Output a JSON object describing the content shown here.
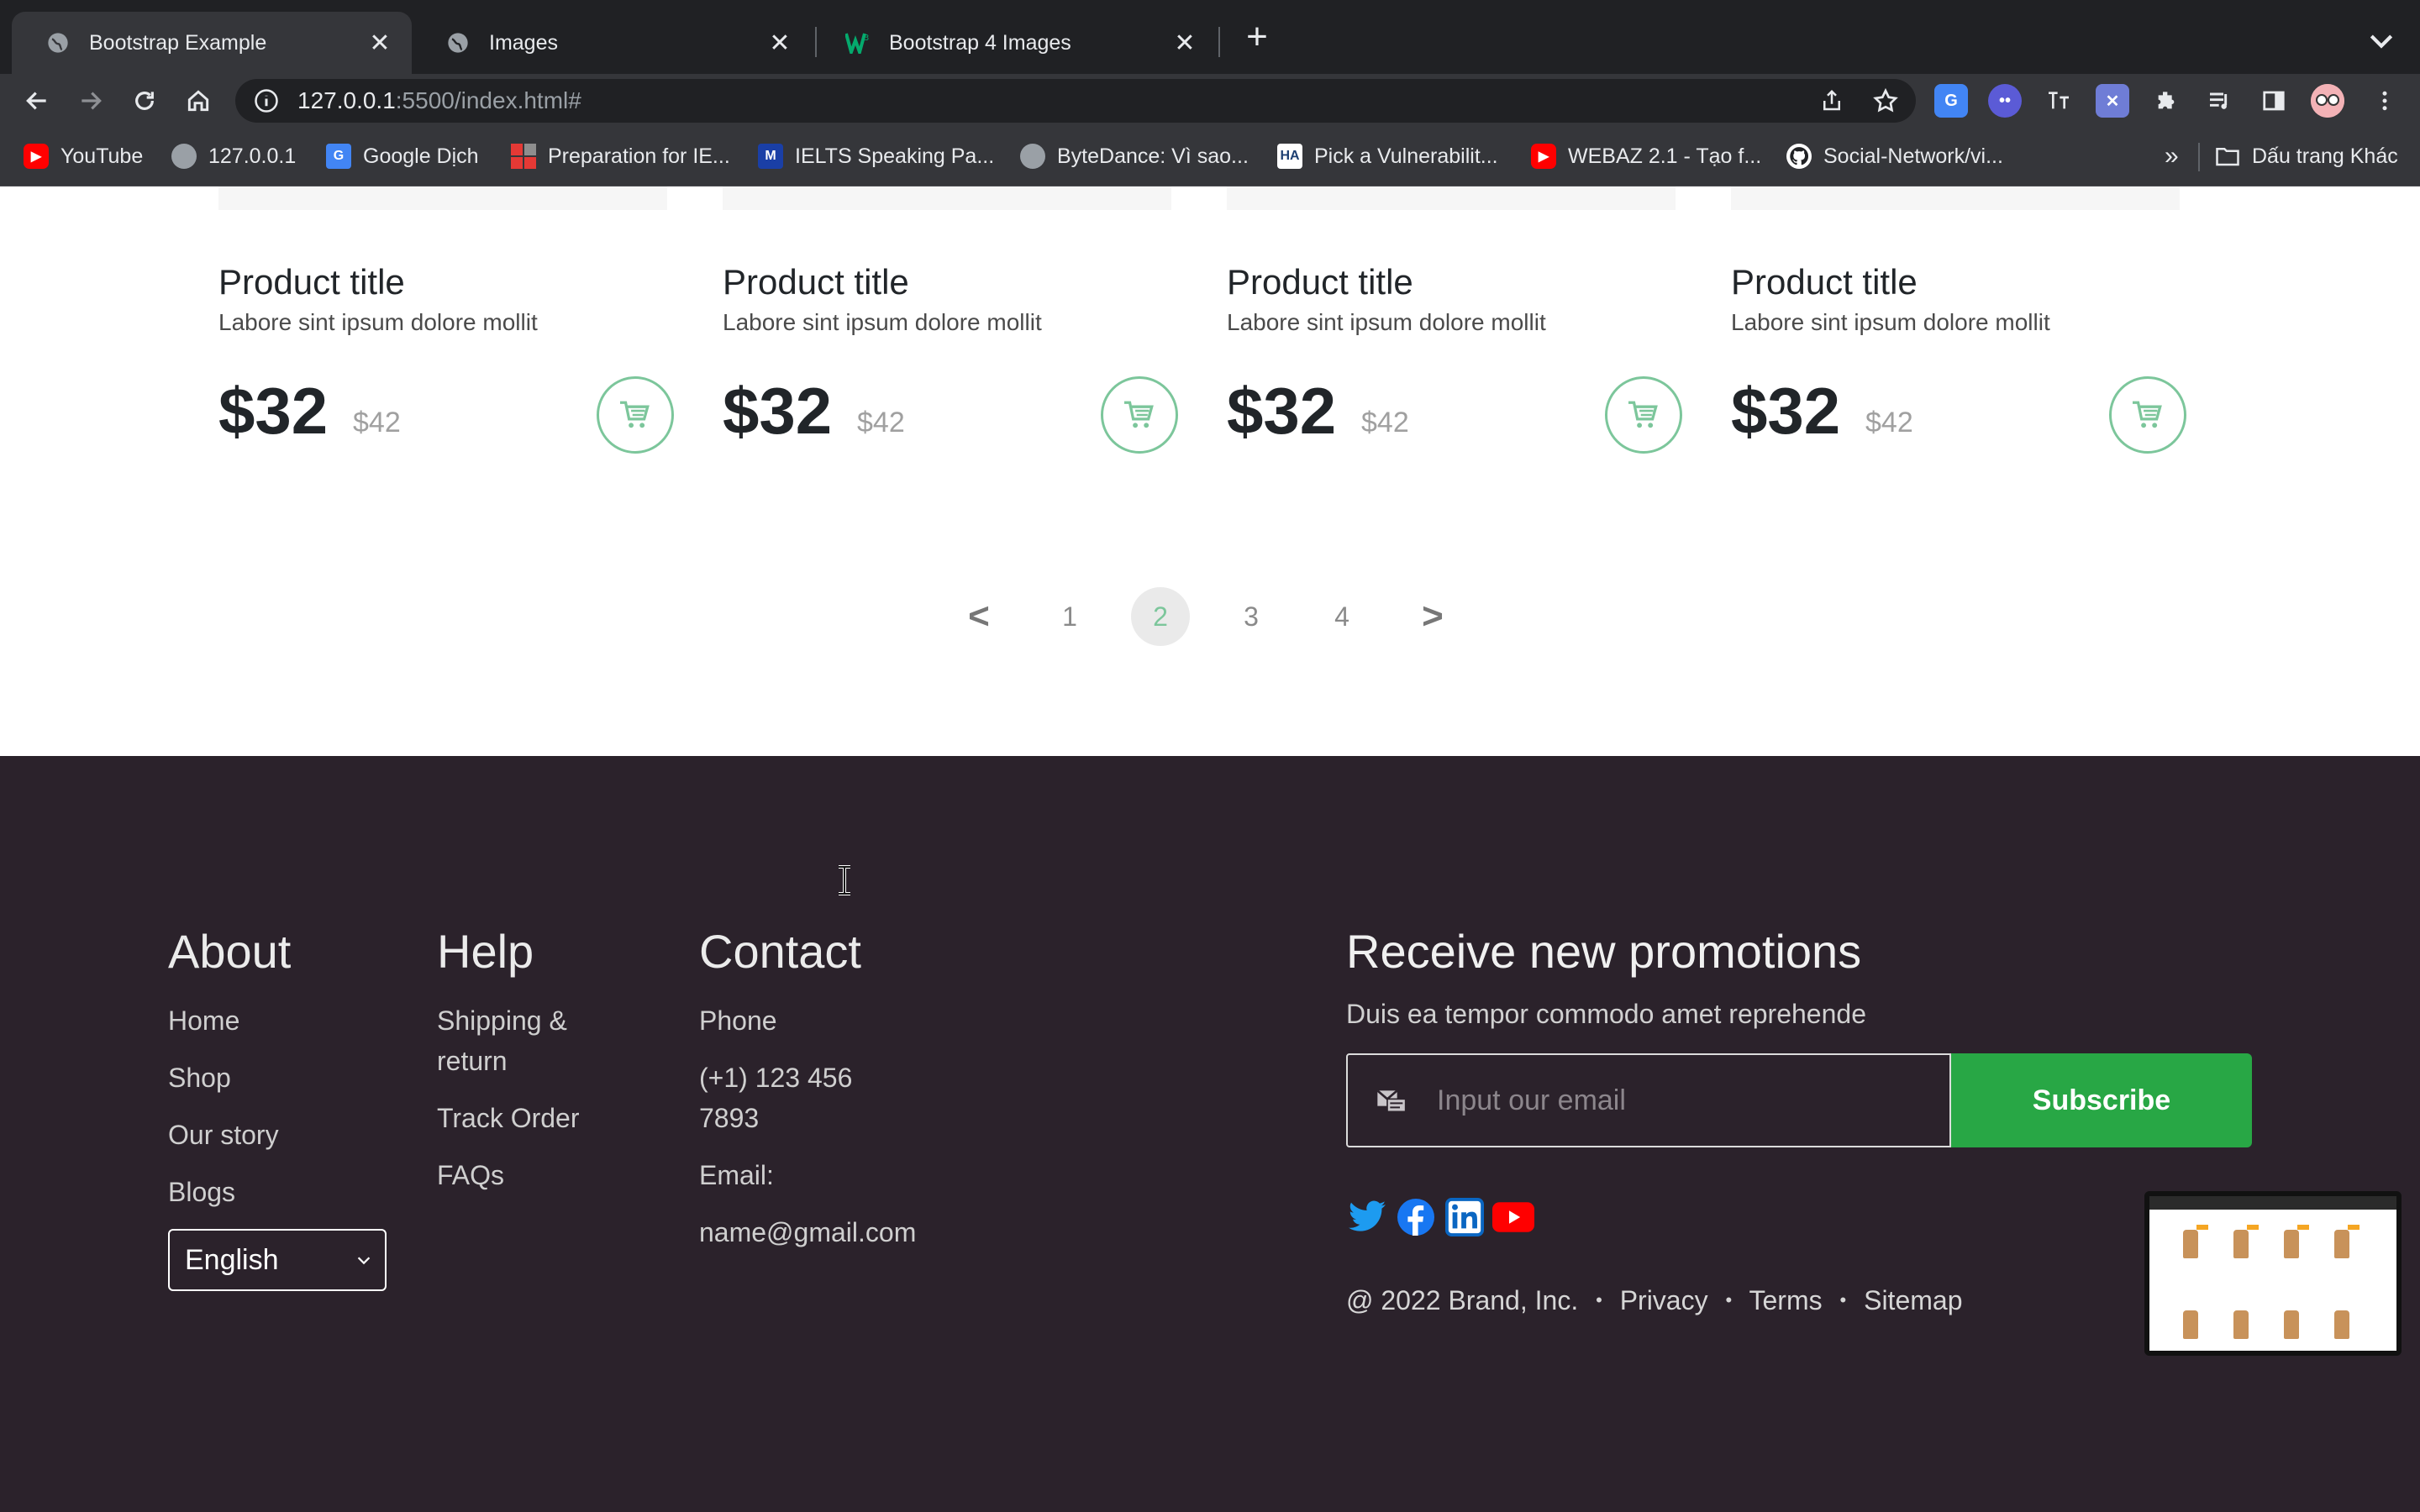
{
  "browser": {
    "tabs": [
      {
        "title": "Bootstrap Example",
        "active": true,
        "icon": "globe-icon"
      },
      {
        "title": "Images",
        "active": false,
        "icon": "globe-icon"
      },
      {
        "title": "Bootstrap 4 Images",
        "active": false,
        "icon": "w3schools-icon"
      }
    ],
    "url_host": "127.0.0.1",
    "url_rest": ":5500/index.html#",
    "bookmarks": [
      {
        "label": "YouTube",
        "icon": "youtube-icon"
      },
      {
        "label": "127.0.0.1",
        "icon": "globe-icon"
      },
      {
        "label": "Google Dịch",
        "icon": "google-translate-icon"
      },
      {
        "label": "Preparation for IE...",
        "icon": "grid-icon"
      },
      {
        "label": "IELTS Speaking Pa...",
        "icon": "ielts-icon"
      },
      {
        "label": "ByteDance: Vì sao...",
        "icon": "globe-icon"
      },
      {
        "label": "Pick a Vulnerabilit...",
        "icon": "ha-icon"
      },
      {
        "label": "WEBAZ 2.1 - Tạo f...",
        "icon": "youtube-icon"
      },
      {
        "label": "Social-Network/vi...",
        "icon": "github-icon"
      }
    ],
    "bookmarks_overflow": "»",
    "other_bookmarks": "Dấu trang Khác"
  },
  "products": [
    {
      "title": "Product title",
      "desc": "Labore sint ipsum dolore mollit",
      "price": "$32",
      "old_price": "$42"
    },
    {
      "title": "Product title",
      "desc": "Labore sint ipsum dolore mollit",
      "price": "$32",
      "old_price": "$42"
    },
    {
      "title": "Product title",
      "desc": "Labore sint ipsum dolore mollit",
      "price": "$32",
      "old_price": "$42"
    },
    {
      "title": "Product title",
      "desc": "Labore sint ipsum dolore mollit",
      "price": "$32",
      "old_price": "$42"
    }
  ],
  "pagination": {
    "prev": "<",
    "pages": [
      "1",
      "2",
      "3",
      "4"
    ],
    "active_page": "2",
    "next": ">"
  },
  "footer": {
    "about": {
      "heading": "About",
      "links": [
        "Home",
        "Shop",
        "Our story",
        "Blogs"
      ]
    },
    "language": "English",
    "help": {
      "heading": "Help",
      "links": [
        "Shipping & return",
        "Track Order",
        "FAQs"
      ]
    },
    "contact": {
      "heading": "Contact",
      "phone_label": "Phone",
      "phone": "(+1) 123 456 7893",
      "email_label": "Email:",
      "email": "name@gmail.com"
    },
    "promo": {
      "heading": "Receive new promotions",
      "subtitle": "Duis ea tempor commodo amet reprehende",
      "email_placeholder": "Input our email",
      "subscribe": "Subscribe"
    },
    "social": [
      "twitter-icon",
      "facebook-icon",
      "linkedin-icon",
      "youtube-icon"
    ],
    "copyright": "@ 2022 Brand, Inc.",
    "legal_links": [
      "Privacy",
      "Terms",
      "Sitemap"
    ]
  },
  "colors": {
    "accent_green": "#28a745",
    "cart_border": "#7cc69b",
    "footer_bg": "#2b222b"
  }
}
